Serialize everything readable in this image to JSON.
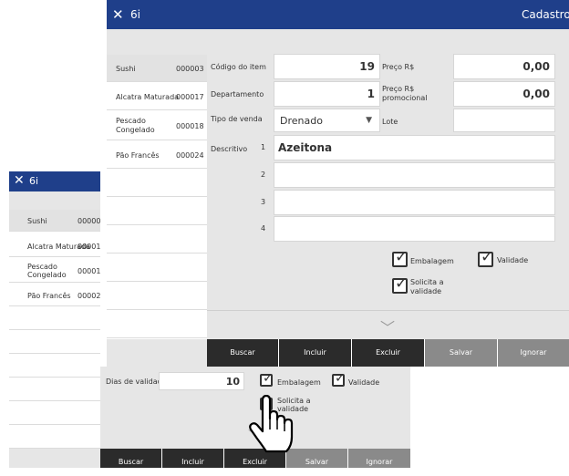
{
  "app_title": "6i",
  "window_title": "Cadastro",
  "front": {
    "list": [
      {
        "name": "Sushi",
        "code": "000003"
      },
      {
        "name": "Alcatra Maturada",
        "code": "000017"
      },
      {
        "name": "Pescado\nCongelado",
        "code": "000018"
      },
      {
        "name": "Pão Francês",
        "code": "000024"
      }
    ],
    "labels": {
      "codigo": "Código do item",
      "departamento": "Departamento",
      "tipo_venda": "Tipo de venda",
      "descritivo": "Descritivo",
      "preco": "Preço R$",
      "preco_promo": "Preço R$\npromocional",
      "lote": "Lote"
    },
    "values": {
      "codigo": "19",
      "departamento": "1",
      "tipo_venda": "Drenado",
      "preco": "0,00",
      "preco_promo": "0,00",
      "lote": ""
    },
    "descritivo_lines": [
      {
        "n": "1",
        "text": "Azeitona"
      },
      {
        "n": "2",
        "text": ""
      },
      {
        "n": "3",
        "text": ""
      },
      {
        "n": "4",
        "text": ""
      }
    ],
    "checks": {
      "embalagem": "Embalagem",
      "validade": "Validade",
      "solicita": "Solicita a\nvalidade"
    },
    "buttons": [
      "Buscar",
      "Incluir",
      "Excluir",
      "Salvar",
      "Ignorar"
    ]
  },
  "back": {
    "list": [
      {
        "name": "Sushi",
        "code": "00000"
      },
      {
        "name": "Alcatra Maturada",
        "code": "00001"
      },
      {
        "name": "Pescado\nCongelado",
        "code": "00001"
      },
      {
        "name": "Pão Francês",
        "code": "00002"
      }
    ],
    "dias_label": "Dias de validade",
    "dias_value": "10",
    "checks": {
      "embalagem": "Embalagem",
      "validade": "Validade",
      "solicita": "Solicita a\nvalidade"
    },
    "buttons": [
      "Buscar",
      "Incluir",
      "Excluir",
      "Salvar",
      "Ignorar"
    ]
  },
  "colors": {
    "titlebar": "#1f3f8a",
    "panel": "#e6e6e6",
    "button_dark": "#2b2b2b",
    "button_light": "#8a8a8a"
  }
}
